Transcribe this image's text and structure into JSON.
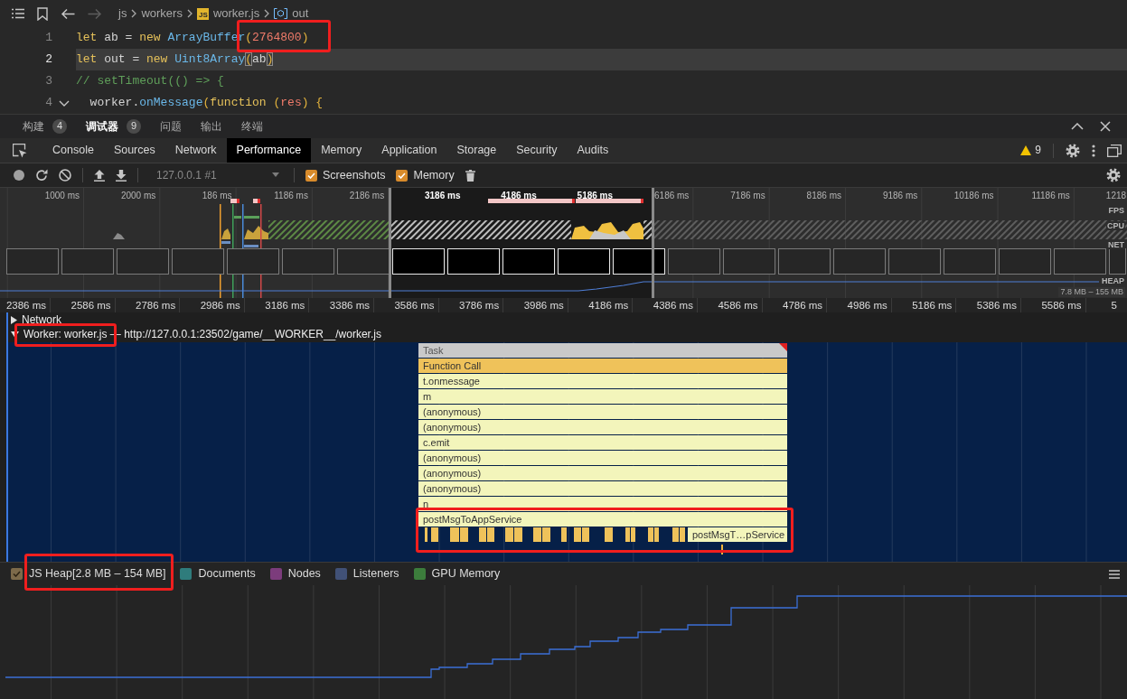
{
  "editor": {
    "breadcrumb": [
      {
        "label": "js",
        "kind": "folder"
      },
      {
        "label": "workers",
        "kind": "folder"
      },
      {
        "label": "worker.js",
        "kind": "file",
        "badge": "JS"
      },
      {
        "label": "out",
        "kind": "symbol"
      }
    ],
    "lines": [
      {
        "number": "1",
        "current": false,
        "foldable": false,
        "tokens": [
          {
            "text": "let",
            "kind": "keyword"
          },
          {
            "text": " ab = ",
            "kind": "plain"
          },
          {
            "text": "new",
            "kind": "keyword"
          },
          {
            "text": " ArrayBuffer",
            "kind": "type"
          },
          {
            "text": "(",
            "kind": "paren"
          },
          {
            "text": "2764800",
            "kind": "number"
          },
          {
            "text": ")",
            "kind": "paren"
          }
        ]
      },
      {
        "number": "2",
        "current": true,
        "foldable": false,
        "tokens": [
          {
            "text": "let",
            "kind": "keyword"
          },
          {
            "text": " out = ",
            "kind": "plain"
          },
          {
            "text": "new",
            "kind": "keyword"
          },
          {
            "text": " Uint8Array",
            "kind": "type"
          },
          {
            "text": "(",
            "kind": "match"
          },
          {
            "text": "ab",
            "kind": "plain"
          },
          {
            "text": ")",
            "kind": "match"
          }
        ]
      },
      {
        "number": "3",
        "current": false,
        "foldable": false,
        "tokens": [
          {
            "text": "// setTimeout(() => {",
            "kind": "comment"
          }
        ]
      },
      {
        "number": "4",
        "current": false,
        "foldable": true,
        "tokens": [
          {
            "text": "  worker.",
            "kind": "plain"
          },
          {
            "text": "onMessage",
            "kind": "method"
          },
          {
            "text": "(",
            "kind": "paren"
          },
          {
            "text": "function",
            "kind": "keyword"
          },
          {
            "text": " (",
            "kind": "paren"
          },
          {
            "text": "res",
            "kind": "param"
          },
          {
            "text": ")",
            "kind": "paren"
          },
          {
            "text": " {",
            "kind": "paren"
          }
        ]
      }
    ]
  },
  "panel_tabs": [
    {
      "label": "构建",
      "badge": "4",
      "selected": false
    },
    {
      "label": "调试器",
      "badge": "9",
      "selected": true
    },
    {
      "label": "问题",
      "selected": false
    },
    {
      "label": "输出",
      "selected": false
    },
    {
      "label": "终端",
      "selected": false
    }
  ],
  "devtools_tabs": [
    {
      "label": "Console",
      "selected": false
    },
    {
      "label": "Sources",
      "selected": false
    },
    {
      "label": "Network",
      "selected": false
    },
    {
      "label": "Performance",
      "selected": true
    },
    {
      "label": "Memory",
      "selected": false
    },
    {
      "label": "Application",
      "selected": false
    },
    {
      "label": "Storage",
      "selected": false
    },
    {
      "label": "Security",
      "selected": false
    },
    {
      "label": "Audits",
      "selected": false
    }
  ],
  "warnings": {
    "count": "9"
  },
  "toolbar": {
    "target": "127.0.0.1 #1",
    "checkboxes": [
      {
        "label": "Screenshots",
        "checked": true
      },
      {
        "label": "Memory",
        "checked": true
      }
    ]
  },
  "overview": {
    "ruler": [
      {
        "label": "1000 ms",
        "in_selection": false
      },
      {
        "label": "2000 ms",
        "in_selection": false
      },
      {
        "label": "186 ms",
        "in_selection": false
      },
      {
        "label": "1186 ms",
        "in_selection": false
      },
      {
        "label": "2186 ms",
        "in_selection": false
      },
      {
        "label": "3186 ms",
        "in_selection": true
      },
      {
        "label": "4186 ms",
        "in_selection": true
      },
      {
        "label": "5186 ms",
        "in_selection": true
      },
      {
        "label": "6186 ms",
        "in_selection": false
      },
      {
        "label": "7186 ms",
        "in_selection": false
      },
      {
        "label": "8186 ms",
        "in_selection": false
      },
      {
        "label": "9186 ms",
        "in_selection": false
      },
      {
        "label": "10186 ms",
        "in_selection": false
      },
      {
        "label": "11186 ms",
        "in_selection": false
      },
      {
        "label": "1218",
        "in_selection": false
      }
    ],
    "tracks": [
      "FPS",
      "CPU",
      "NET",
      "HEAP"
    ],
    "heap_range": "7.8 MB – 155 MB"
  },
  "timeline": {
    "ruler": [
      "2386 ms",
      "2586 ms",
      "2786 ms",
      "2986 ms",
      "3186 ms",
      "3386 ms",
      "3586 ms",
      "3786 ms",
      "3986 ms",
      "4186 ms",
      "4386 ms",
      "4586 ms",
      "4786 ms",
      "4986 ms",
      "5186 ms",
      "5386 ms",
      "5586 ms",
      "5"
    ],
    "tracks": [
      {
        "label": "Network",
        "expanded": false
      },
      {
        "label": "Worker: worker.js — http://127.0.0.1:23502/game/__WORKER__/worker.js",
        "expanded": true
      }
    ],
    "flame": [
      {
        "label": "Task",
        "kind": "task",
        "long": true
      },
      {
        "label": "Function Call",
        "kind": "call",
        "long": false
      },
      {
        "label": "t.onmessage",
        "kind": "script",
        "long": false
      },
      {
        "label": "m",
        "kind": "script",
        "long": false
      },
      {
        "label": "(anonymous)",
        "kind": "script",
        "long": false
      },
      {
        "label": "(anonymous)",
        "kind": "script",
        "long": false
      },
      {
        "label": "c.emit",
        "kind": "script",
        "long": false
      },
      {
        "label": "(anonymous)",
        "kind": "script",
        "long": false
      },
      {
        "label": "(anonymous)",
        "kind": "script",
        "long": false
      },
      {
        "label": "(anonymous)",
        "kind": "script",
        "long": false
      },
      {
        "label": "n",
        "kind": "script",
        "long": false
      },
      {
        "label": "postMsgToAppService",
        "kind": "script",
        "long": false
      }
    ],
    "truncated_entry": "postMsgT…pService"
  },
  "memory": {
    "counters": [
      {
        "label": "JS Heap[2.8 MB – 154 MB]",
        "checked": true,
        "color": "#7d6a4a"
      },
      {
        "label": "Documents",
        "checked": false,
        "color": "#2f7c7c"
      },
      {
        "label": "Nodes",
        "checked": false,
        "color": "#7c3c7c"
      },
      {
        "label": "Listeners",
        "checked": false,
        "color": "#415177"
      },
      {
        "label": "GPU Memory",
        "checked": false,
        "color": "#3c7d3c"
      }
    ]
  },
  "annotations": [
    {
      "kind": "highlight-frame"
    },
    {
      "kind": "highlight-frame"
    },
    {
      "kind": "highlight-frame"
    },
    {
      "kind": "highlight-frame"
    }
  ]
}
